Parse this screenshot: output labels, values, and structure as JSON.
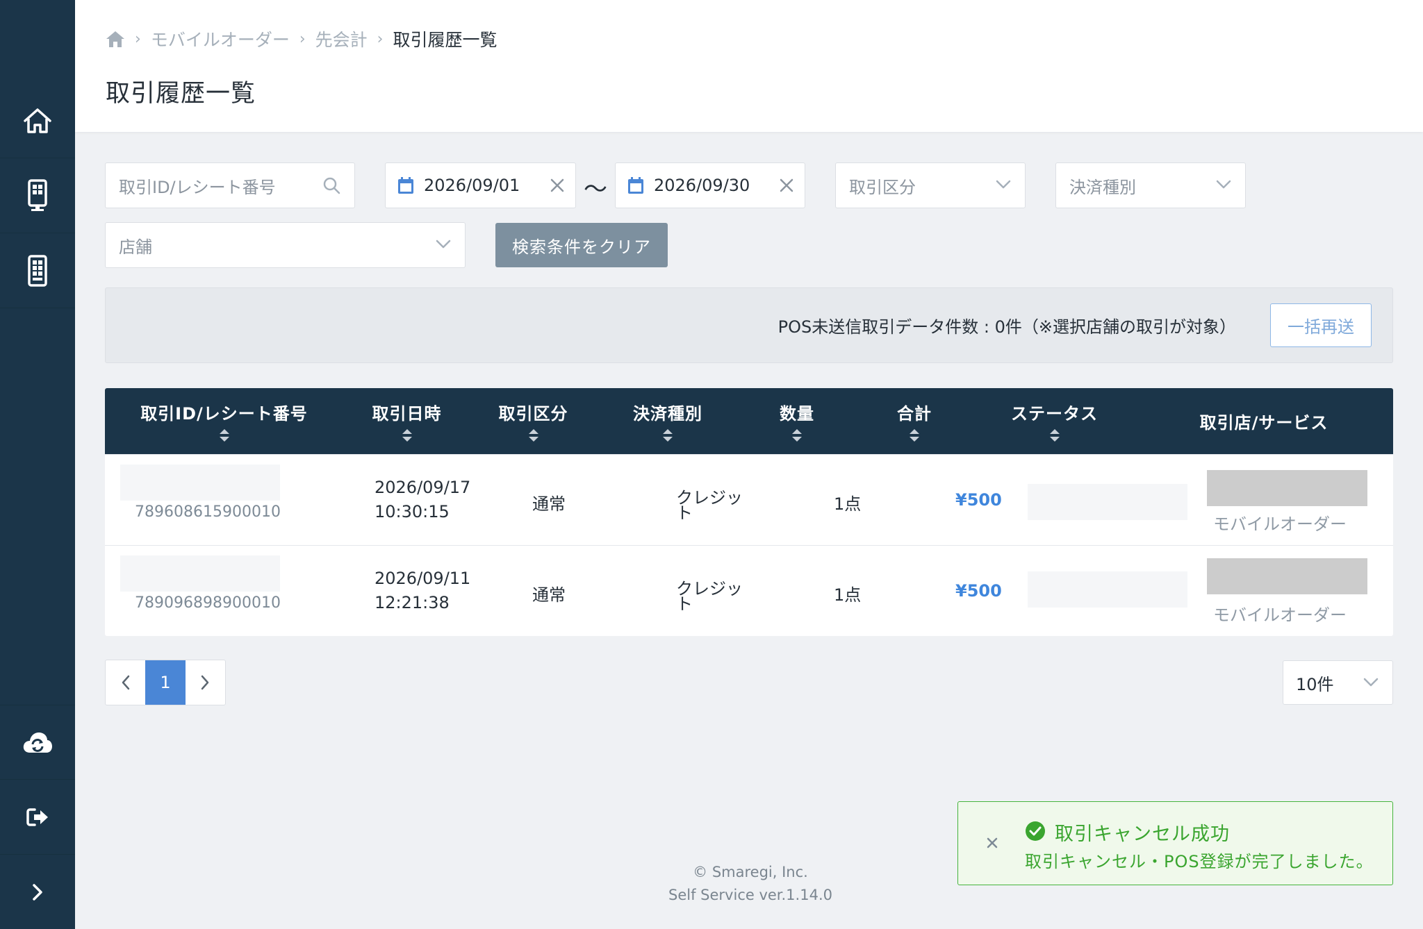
{
  "breadcrumb": {
    "items": [
      "モバイルオーダー",
      "先会計",
      "取引履歴一覧"
    ]
  },
  "page_title": "取引履歴一覧",
  "filters": {
    "search_placeholder": "取引ID/レシート番号",
    "date_from": "2026/09/01",
    "date_separator": "〜",
    "date_to": "2026/09/30",
    "transaction_type_placeholder": "取引区分",
    "payment_type_placeholder": "決済種別",
    "store_placeholder": "店舗",
    "clear_label": "検索条件をクリア"
  },
  "pos_notice": {
    "text": "POS未送信取引データ件数 : 0件（※選択店舗の取引が対象）",
    "resend_label": "一括再送"
  },
  "table": {
    "headers": [
      "取引ID/レシート番号",
      "取引日時",
      "取引区分",
      "決済種別",
      "数量",
      "合計",
      "ステータス",
      "取引店/サービス"
    ],
    "rows": [
      {
        "id": "789608615900010",
        "date": "2026/09/17",
        "time": "10:30:15",
        "type": "通常",
        "payment_line1": "クレジッ",
        "payment_line2": "ト",
        "qty": "1点",
        "total": "¥500",
        "service": "モバイルオーダー"
      },
      {
        "id": "789096898900010",
        "date": "2026/09/11",
        "time": "12:21:38",
        "type": "通常",
        "payment_line1": "クレジッ",
        "payment_line2": "ト",
        "qty": "1点",
        "total": "¥500",
        "service": "モバイルオーダー"
      }
    ]
  },
  "pagination": {
    "current_page": "1",
    "per_page": "10件"
  },
  "footer": {
    "copyright": "© Smaregi, Inc.",
    "version": "Self Service ver.1.14.0"
  },
  "toast": {
    "title": "取引キャンセル成功",
    "message": "取引キャンセル・POS登録が完了しました。"
  },
  "colors": {
    "sidebar": "#1b3549",
    "accent": "#4a86d6",
    "success": "#3aa52f"
  }
}
